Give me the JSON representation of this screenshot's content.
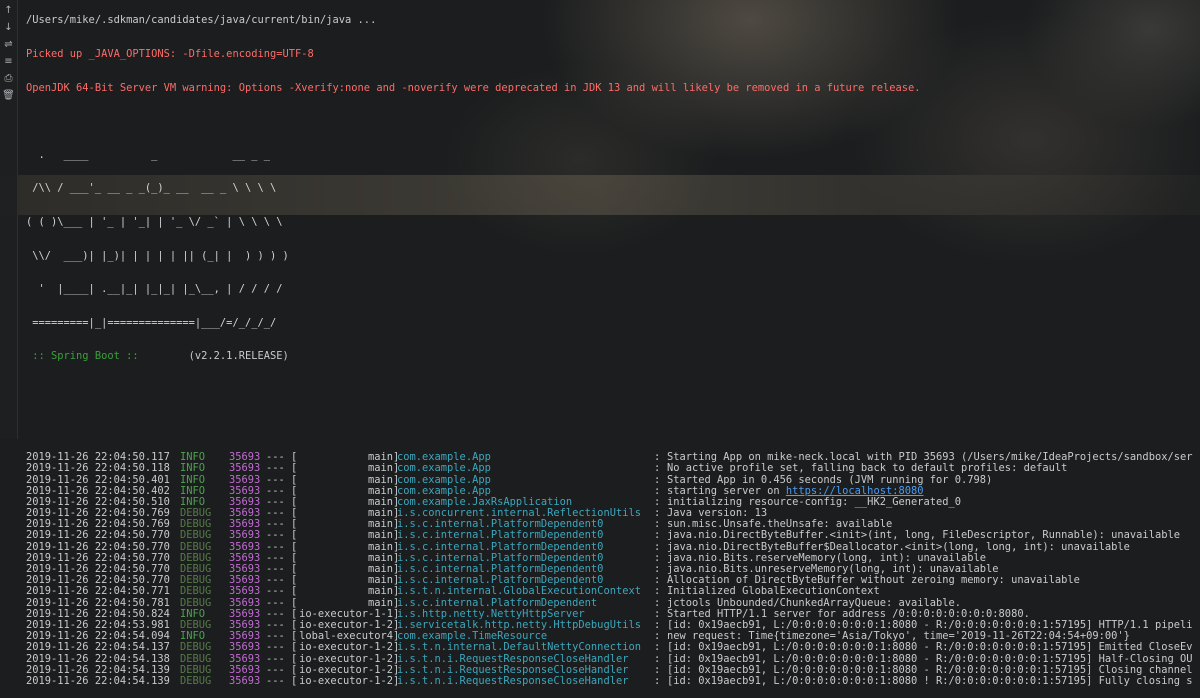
{
  "gutter_icons": [
    "arrow-up-icon",
    "arrow-down-icon",
    "soft-wrap-icon",
    "scroll-to-end-icon",
    "print-icon",
    "trash-icon"
  ],
  "header_lines": [
    "/Users/mike/.sdkman/candidates/java/current/bin/java ...",
    "Picked up _JAVA_OPTIONS: -Dfile.encoding=UTF-8",
    "OpenJDK 64-Bit Server VM warning: Options -Xverify:none and -noverify were deprecated in JDK 13 and will likely be removed in a future release."
  ],
  "banner": [
    "  .   ____          _            __ _ _",
    " /\\\\ / ___'_ __ _ _(_)_ __  __ _ \\ \\ \\ \\",
    "( ( )\\___ | '_ | '_| | '_ \\/ _` | \\ \\ \\ \\",
    " \\\\/  ___)| |_)| | | | | || (_| |  ) ) ) )",
    "  '  |____| .__|_| |_|_| |_\\__, | / / / /",
    " =========|_|==============|___/=/_/_/_/"
  ],
  "boot": {
    "label": " :: Spring Boot :: ",
    "version": "       (v2.2.1.RELEASE)"
  },
  "log": [
    {
      "ts": "2019-11-26 22:04:50.117",
      "level": "INFO",
      "pid": "35693",
      "thread": "main",
      "logger": "com.example.App",
      "msg": "Starting App on mike-neck.local with PID 35693 (/Users/mike/IdeaProjects/sandbox/ser"
    },
    {
      "ts": "2019-11-26 22:04:50.118",
      "level": "INFO",
      "pid": "35693",
      "thread": "main",
      "logger": "com.example.App",
      "msg": "No active profile set, falling back to default profiles: default"
    },
    {
      "ts": "2019-11-26 22:04:50.401",
      "level": "INFO",
      "pid": "35693",
      "thread": "main",
      "logger": "com.example.App",
      "msg": "Started App in 0.456 seconds (JVM running for 0.798)"
    },
    {
      "ts": "2019-11-26 22:04:50.402",
      "level": "INFO",
      "pid": "35693",
      "thread": "main",
      "logger": "com.example.App",
      "msg": "starting server on ",
      "link": "https://localhost:8080"
    },
    {
      "ts": "2019-11-26 22:04:50.510",
      "level": "INFO",
      "pid": "35693",
      "thread": "main",
      "logger": "com.example.JaxRsApplication",
      "msg": "initializing resource-config: __HK2_Generated_0"
    },
    {
      "ts": "2019-11-26 22:04:50.769",
      "level": "DEBUG",
      "pid": "35693",
      "thread": "main",
      "logger": "i.s.concurrent.internal.ReflectionUtils",
      "msg": "Java version: 13"
    },
    {
      "ts": "2019-11-26 22:04:50.769",
      "level": "DEBUG",
      "pid": "35693",
      "thread": "main",
      "logger": "i.s.c.internal.PlatformDependent0",
      "msg": "sun.misc.Unsafe.theUnsafe: available"
    },
    {
      "ts": "2019-11-26 22:04:50.770",
      "level": "DEBUG",
      "pid": "35693",
      "thread": "main",
      "logger": "i.s.c.internal.PlatformDependent0",
      "msg": "java.nio.DirectByteBuffer.<init>(int, long, FileDescriptor, Runnable): unavailable"
    },
    {
      "ts": "2019-11-26 22:04:50.770",
      "level": "DEBUG",
      "pid": "35693",
      "thread": "main",
      "logger": "i.s.c.internal.PlatformDependent0",
      "msg": "java.nio.DirectByteBuffer$Deallocator.<init>(long, long, int): unavailable"
    },
    {
      "ts": "2019-11-26 22:04:50.770",
      "level": "DEBUG",
      "pid": "35693",
      "thread": "main",
      "logger": "i.s.c.internal.PlatformDependent0",
      "msg": "java.nio.Bits.reserveMemory(long, int): unavailable"
    },
    {
      "ts": "2019-11-26 22:04:50.770",
      "level": "DEBUG",
      "pid": "35693",
      "thread": "main",
      "logger": "i.s.c.internal.PlatformDependent0",
      "msg": "java.nio.Bits.unreserveMemory(long, int): unavailable"
    },
    {
      "ts": "2019-11-26 22:04:50.770",
      "level": "DEBUG",
      "pid": "35693",
      "thread": "main",
      "logger": "i.s.c.internal.PlatformDependent0",
      "msg": "Allocation of DirectByteBuffer without zeroing memory: unavailable"
    },
    {
      "ts": "2019-11-26 22:04:50.771",
      "level": "DEBUG",
      "pid": "35693",
      "thread": "main",
      "logger": "i.s.t.n.internal.GlobalExecutionContext",
      "msg": "Initialized GlobalExecutionContext"
    },
    {
      "ts": "2019-11-26 22:04:50.781",
      "level": "DEBUG",
      "pid": "35693",
      "thread": "main",
      "logger": "i.s.c.internal.PlatformDependent",
      "msg": "jctools Unbounded/ChunkedArrayQueue: available."
    },
    {
      "ts": "2019-11-26 22:04:50.824",
      "level": "INFO",
      "pid": "35693",
      "thread": "io-executor-1-1",
      "logger": "i.s.http.netty.NettyHttpServer",
      "msg": "Started HTTP/1.1 server for address /0:0:0:0:0:0:0:0:8080."
    },
    {
      "ts": "2019-11-26 22:04:53.981",
      "level": "DEBUG",
      "pid": "35693",
      "thread": "io-executor-1-2",
      "logger": "i.servicetalk.http.netty.HttpDebugUtils",
      "msg": "[id: 0x19aecb91, L:/0:0:0:0:0:0:0:1:8080 - R:/0:0:0:0:0:0:0:1:57195] HTTP/1.1 pipeli"
    },
    {
      "ts": "2019-11-26 22:04:54.094",
      "level": "INFO",
      "pid": "35693",
      "thread": "lobal-executor4",
      "logger": "com.example.TimeResource",
      "msg": "new request: Time{timezone='Asia/Tokyo', time='2019-11-26T22:04:54+09:00'}"
    },
    {
      "ts": "2019-11-26 22:04:54.137",
      "level": "DEBUG",
      "pid": "35693",
      "thread": "io-executor-1-2",
      "logger": "i.s.t.n.internal.DefaultNettyConnection",
      "msg": "[id: 0x19aecb91, L:/0:0:0:0:0:0:0:1:8080 - R:/0:0:0:0:0:0:0:1:57195] Emitted CloseEv"
    },
    {
      "ts": "2019-11-26 22:04:54.138",
      "level": "DEBUG",
      "pid": "35693",
      "thread": "io-executor-1-2",
      "logger": "i.s.t.n.i.RequestResponseCloseHandler",
      "msg": "[id: 0x19aecb91, L:/0:0:0:0:0:0:0:1:8080 - R:/0:0:0:0:0:0:0:1:57195] Half-Closing OU"
    },
    {
      "ts": "2019-11-26 22:04:54.139",
      "level": "DEBUG",
      "pid": "35693",
      "thread": "io-executor-1-2",
      "logger": "i.s.t.n.i.RequestResponseCloseHandler",
      "msg": "[id: 0x19aecb91, L:/0:0:0:0:0:0:0:1:8080 - R:/0:0:0:0:0:0:0:1:57195] Closing channel"
    },
    {
      "ts": "2019-11-26 22:04:54.139",
      "level": "DEBUG",
      "pid": "35693",
      "thread": "io-executor-1-2",
      "logger": "i.s.t.n.i.RequestResponseCloseHandler",
      "msg": "[id: 0x19aecb91, L:/0:0:0:0:0:0:0:1:8080 ! R:/0:0:0:0:0:0:0:1:57195] Fully closing s"
    }
  ]
}
